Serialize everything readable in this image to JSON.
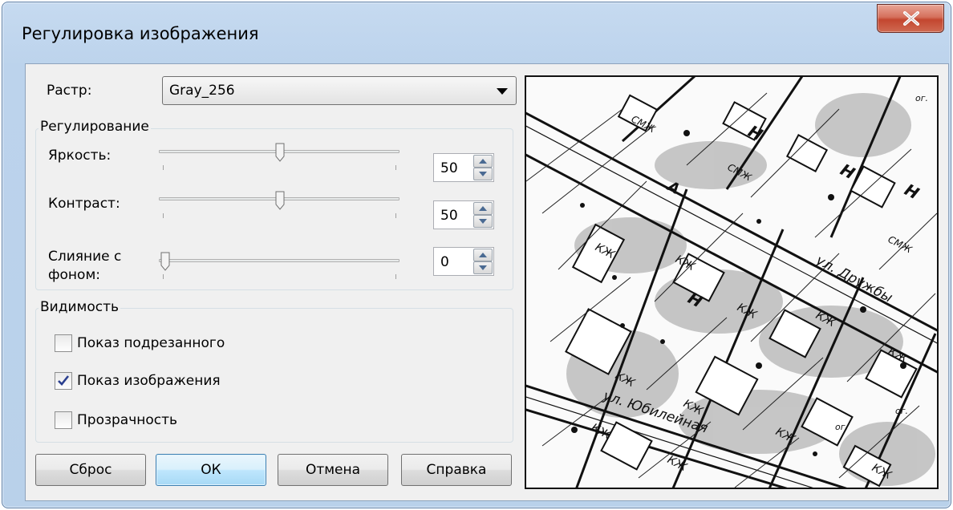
{
  "window": {
    "title": "Регулировка изображения",
    "close_icon": "close-x-icon"
  },
  "raster": {
    "label": "Растр:",
    "value": "Gray_256"
  },
  "adjust": {
    "legend": "Регулирование",
    "brightness": {
      "label": "Яркость:",
      "value": "50",
      "level": 50
    },
    "contrast": {
      "label": "Контраст:",
      "value": "50",
      "level": 50
    },
    "blend": {
      "label_line1": "Слияние с",
      "label_line2": "фоном:",
      "value": "0",
      "level": 0
    }
  },
  "visibility": {
    "legend": "Видимость",
    "show_clipped": {
      "label": "Показ подрезанного",
      "checked": false
    },
    "show_image": {
      "label": "Показ изображения",
      "checked": true
    },
    "transparency": {
      "label": "Прозрачность",
      "checked": false
    }
  },
  "buttons": {
    "reset": "Сброс",
    "ok": "ОК",
    "cancel": "Отмена",
    "help": "Справка"
  },
  "preview": {
    "labels": [
      "А",
      "ул. Дружбы",
      "ул. Юбилейная",
      "КЖ",
      "Н",
      "СМЖ",
      "ог."
    ],
    "colors": {
      "ink": "#111111",
      "paper": "#fafafa",
      "shade": "#9a9a9a"
    }
  },
  "colors": {
    "title_bar": "#bcd3ec",
    "client": "#f0f0f0",
    "close": "#c3462f",
    "default_button": "#bee6fd"
  }
}
